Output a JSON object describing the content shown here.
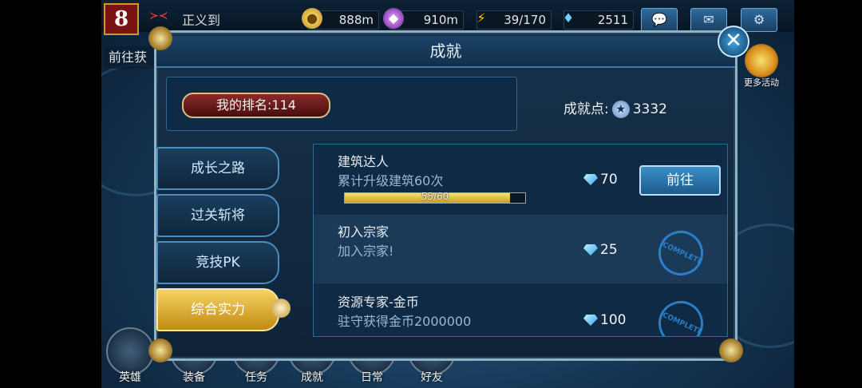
{
  "topbar": {
    "level": "8",
    "player_name": "正义到",
    "vip_label": "≻≺",
    "resources": [
      {
        "icon": "gold-coin-icon",
        "value": "888m"
      },
      {
        "icon": "purple-crystal-icon",
        "value": "910m"
      },
      {
        "icon": "lightning-icon",
        "value": "39/170"
      },
      {
        "icon": "diamond-icon",
        "value": "2511"
      }
    ],
    "left_hint": "前往获",
    "more_activities": "更多活动"
  },
  "dialog": {
    "title": "成就",
    "rank_label": "我的排名:114",
    "points_label": "成就点:",
    "points_value": "3332"
  },
  "tabs": [
    {
      "label": "成长之路",
      "active": false
    },
    {
      "label": "过关斩将",
      "active": false
    },
    {
      "label": "竞技PK",
      "active": false
    },
    {
      "label": "综合实力",
      "active": true
    }
  ],
  "achievements": [
    {
      "title": "建筑达人",
      "desc": "累计升级建筑60次",
      "reward": "70",
      "progress_text": "55/60",
      "progress": 0.9167,
      "action": "前往",
      "completed": false
    },
    {
      "title": "初入宗家",
      "desc": "加入宗家!",
      "reward": "25",
      "completed": true,
      "stamp": "COMPLETE"
    },
    {
      "title": "资源专家-金币",
      "desc": "驻守获得金币2000000",
      "reward": "100",
      "completed": true,
      "stamp": "COMPLETE"
    }
  ],
  "bottom_nav": [
    "英雄",
    "装备",
    "任务",
    "成就",
    "日常",
    "好友"
  ],
  "colors": {
    "accent": "#3a8ec6",
    "active_tab": "#f6d463",
    "rank_pill": "#8a2a2a"
  }
}
